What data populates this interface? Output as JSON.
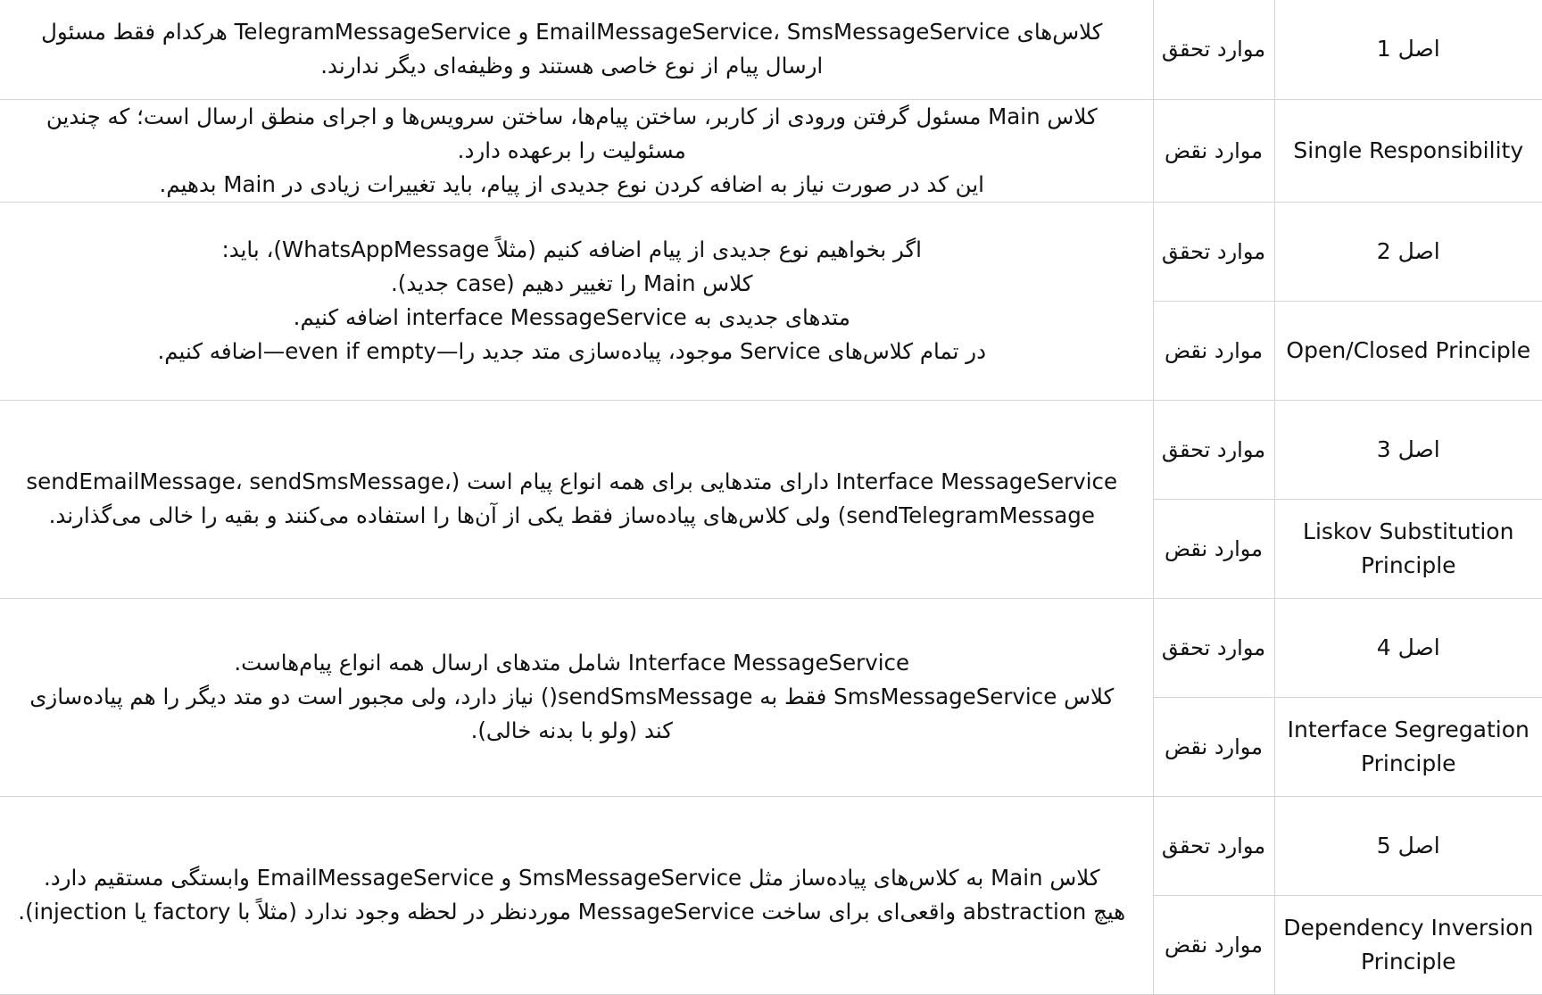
{
  "rows": [
    {
      "principle_num": "اصل 1",
      "principle_name": "Single Responsibility",
      "status_fulfilled": "موارد تحقق",
      "status_violation": "موارد نقض",
      "fulfilled_lines": [
        "کلاس‌های EmailMessageService، SmsMessageService و TelegramMessageService هرکدام فقط مسئول ارسال پیام از نوع خاصی هستند و وظیفه‌ای دیگر ندارند."
      ],
      "violation_lines": [
        "کلاس Main مسئول گرفتن ورودی از کاربر، ساختن پیام‌ها، ساختن سرویس‌ها و اجرای منطق ارسال است؛ که چندین مسئولیت را برعهده دارد.",
        "این کد در صورت نیاز به اضافه کردن نوع جدیدی از پیام، باید تغییرات زیادی در Main بدهیم."
      ]
    },
    {
      "principle_num": "اصل 2",
      "principle_name": "Open/Closed Principle",
      "status_fulfilled": "موارد تحقق",
      "status_violation": "موارد نقض",
      "merged_lines": [
        "اگر بخواهیم نوع جدیدی از پیام اضافه کنیم (مثلاً WhatsAppMessage)، باید:",
        "کلاس Main را تغییر دهیم (case جدید).",
        "متدهای جدیدی به interface MessageService اضافه کنیم.",
        "در تمام کلاس‌های Service موجود، پیاده‌سازی متد جدید را—even if empty—اضافه کنیم."
      ]
    },
    {
      "principle_num": "اصل 3",
      "principle_name": "Liskov Substitution Principle",
      "status_fulfilled": "موارد تحقق",
      "status_violation": "موارد نقض",
      "merged_lines": [
        "Interface MessageService دارای متدهایی برای همه انواع پیام است (sendEmailMessage، sendSmsMessage، sendTelegramMessage) ولی کلاس‌های پیاده‌ساز فقط یکی از آن‌ها را استفاده می‌کنند و بقیه را خالی می‌گذارند."
      ]
    },
    {
      "principle_num": "اصل 4",
      "principle_name": "Interface Segregation Principle",
      "status_fulfilled": "موارد تحقق",
      "status_violation": "موارد نقض",
      "merged_lines": [
        "Interface MessageService شامل متدهای ارسال همه انواع پیام‌هاست.",
        "کلاس SmsMessageService فقط به sendSmsMessage() نیاز دارد، ولی مجبور است دو متد دیگر را هم پیاده‌سازی کند (ولو با بدنه خالی)."
      ]
    },
    {
      "principle_num": "اصل 5",
      "principle_name": "Dependency Inversion Principle",
      "status_fulfilled": "موارد تحقق",
      "status_violation": "موارد نقض",
      "merged_lines": [
        "کلاس Main به کلاس‌های پیاده‌ساز مثل SmsMessageService و EmailMessageService وابستگی مستقیم دارد.",
        "هیچ abstraction واقعی‌ای برای ساخت MessageService موردنظر در لحظه وجود ندارد (مثلاً با factory یا injection)."
      ]
    }
  ]
}
